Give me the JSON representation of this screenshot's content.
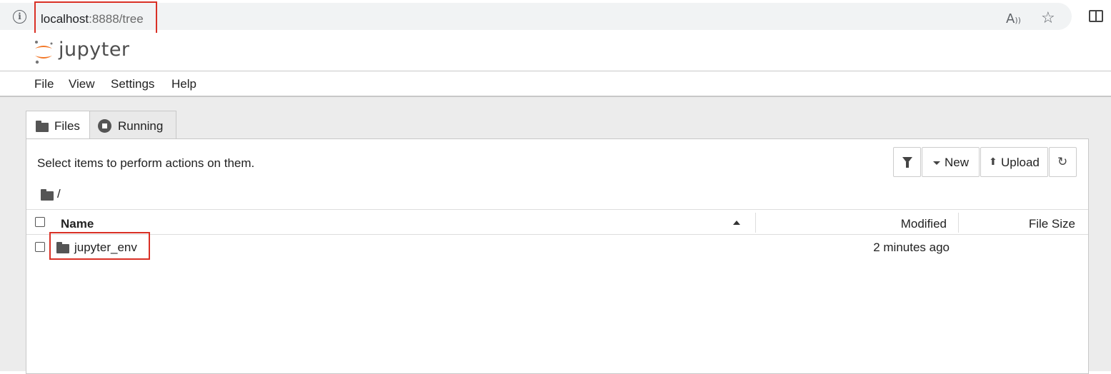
{
  "browser": {
    "url_host": "localhost",
    "url_rest": ":8888/tree",
    "read_aloud_glyph": "A͡",
    "star_glyph": "☆"
  },
  "header": {
    "logo_text": "jupyter"
  },
  "menu": {
    "items": [
      "File",
      "View",
      "Settings",
      "Help"
    ]
  },
  "tabs": [
    {
      "label": "Files",
      "icon": "folder-icon",
      "active": true
    },
    {
      "label": "Running",
      "icon": "stop-circle-icon",
      "active": false
    }
  ],
  "toolbar": {
    "hint": "Select items to perform actions on them.",
    "new_label": "New",
    "upload_label": "Upload"
  },
  "breadcrumb": {
    "separator": "/"
  },
  "file_list": {
    "columns": {
      "name": "Name",
      "modified": "Modified",
      "size": "File Size"
    },
    "rows": [
      {
        "name": "jupyter_env",
        "type": "folder",
        "modified": "2 minutes ago",
        "size": ""
      }
    ]
  },
  "colors": {
    "highlight": "#d93025",
    "jupyter_orange": "#f37726"
  }
}
